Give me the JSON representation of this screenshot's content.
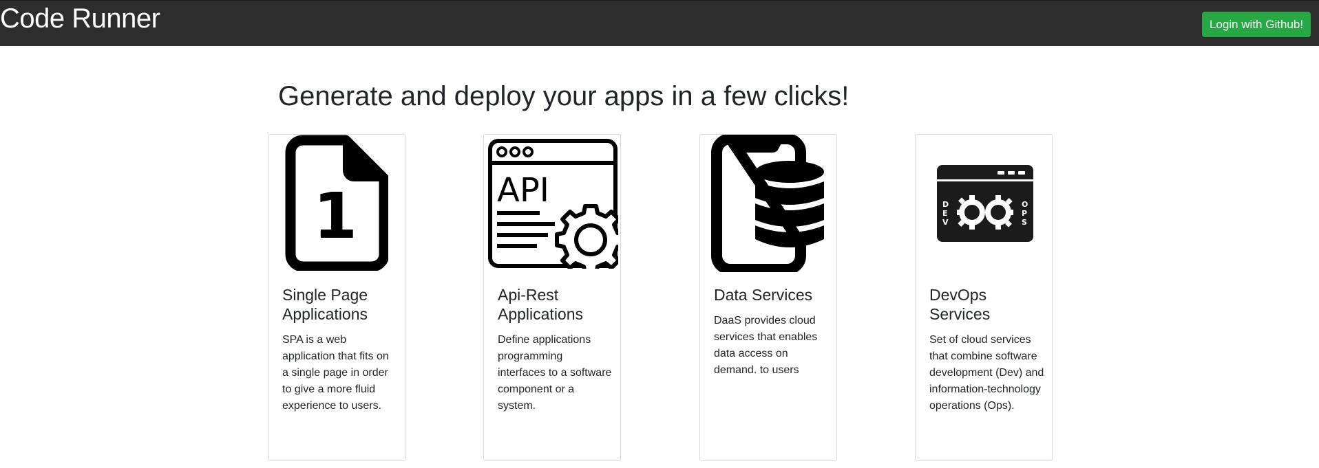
{
  "header": {
    "brand": "Code Runner",
    "login_label": "Login with Github!"
  },
  "main": {
    "headline": "Generate and deploy your apps in a few clicks!"
  },
  "cards": [
    {
      "icon": "single-page-file-icon",
      "icon_text": "1",
      "title": "Single Page Applications",
      "text": "SPA is a web application that fits on a single page in order to give a more fluid experience to users."
    },
    {
      "icon": "api-gear-icon",
      "icon_text": "API",
      "title": "Api-Rest Applications",
      "text": "Define applications programming interfaces to a software component or a system."
    },
    {
      "icon": "phone-database-icon",
      "title": "Data Services",
      "text": "DaaS provides cloud services that enables data access on demand. to users"
    },
    {
      "icon": "devops-infinity-icon",
      "icon_text_left": "DEV",
      "icon_text_right": "OPS",
      "title": "DevOps Services",
      "text": "Set of cloud services that combine software development (Dev) and information-technology operations (Ops)."
    }
  ]
}
